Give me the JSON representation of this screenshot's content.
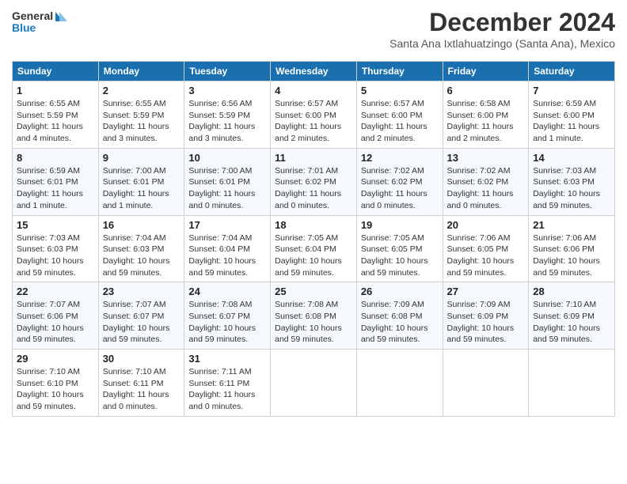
{
  "logo": {
    "line1": "General",
    "line2": "Blue"
  },
  "title": "December 2024",
  "subtitle": "Santa Ana Ixtlahuatzingo (Santa Ana), Mexico",
  "days_of_week": [
    "Sunday",
    "Monday",
    "Tuesday",
    "Wednesday",
    "Thursday",
    "Friday",
    "Saturday"
  ],
  "weeks": [
    [
      {
        "day": "1",
        "info": "Sunrise: 6:55 AM\nSunset: 5:59 PM\nDaylight: 11 hours\nand 4 minutes."
      },
      {
        "day": "2",
        "info": "Sunrise: 6:55 AM\nSunset: 5:59 PM\nDaylight: 11 hours\nand 3 minutes."
      },
      {
        "day": "3",
        "info": "Sunrise: 6:56 AM\nSunset: 5:59 PM\nDaylight: 11 hours\nand 3 minutes."
      },
      {
        "day": "4",
        "info": "Sunrise: 6:57 AM\nSunset: 6:00 PM\nDaylight: 11 hours\nand 2 minutes."
      },
      {
        "day": "5",
        "info": "Sunrise: 6:57 AM\nSunset: 6:00 PM\nDaylight: 11 hours\nand 2 minutes."
      },
      {
        "day": "6",
        "info": "Sunrise: 6:58 AM\nSunset: 6:00 PM\nDaylight: 11 hours\nand 2 minutes."
      },
      {
        "day": "7",
        "info": "Sunrise: 6:59 AM\nSunset: 6:00 PM\nDaylight: 11 hours\nand 1 minute."
      }
    ],
    [
      {
        "day": "8",
        "info": "Sunrise: 6:59 AM\nSunset: 6:01 PM\nDaylight: 11 hours\nand 1 minute."
      },
      {
        "day": "9",
        "info": "Sunrise: 7:00 AM\nSunset: 6:01 PM\nDaylight: 11 hours\nand 1 minute."
      },
      {
        "day": "10",
        "info": "Sunrise: 7:00 AM\nSunset: 6:01 PM\nDaylight: 11 hours\nand 0 minutes."
      },
      {
        "day": "11",
        "info": "Sunrise: 7:01 AM\nSunset: 6:02 PM\nDaylight: 11 hours\nand 0 minutes."
      },
      {
        "day": "12",
        "info": "Sunrise: 7:02 AM\nSunset: 6:02 PM\nDaylight: 11 hours\nand 0 minutes."
      },
      {
        "day": "13",
        "info": "Sunrise: 7:02 AM\nSunset: 6:02 PM\nDaylight: 11 hours\nand 0 minutes."
      },
      {
        "day": "14",
        "info": "Sunrise: 7:03 AM\nSunset: 6:03 PM\nDaylight: 10 hours\nand 59 minutes."
      }
    ],
    [
      {
        "day": "15",
        "info": "Sunrise: 7:03 AM\nSunset: 6:03 PM\nDaylight: 10 hours\nand 59 minutes."
      },
      {
        "day": "16",
        "info": "Sunrise: 7:04 AM\nSunset: 6:03 PM\nDaylight: 10 hours\nand 59 minutes."
      },
      {
        "day": "17",
        "info": "Sunrise: 7:04 AM\nSunset: 6:04 PM\nDaylight: 10 hours\nand 59 minutes."
      },
      {
        "day": "18",
        "info": "Sunrise: 7:05 AM\nSunset: 6:04 PM\nDaylight: 10 hours\nand 59 minutes."
      },
      {
        "day": "19",
        "info": "Sunrise: 7:05 AM\nSunset: 6:05 PM\nDaylight: 10 hours\nand 59 minutes."
      },
      {
        "day": "20",
        "info": "Sunrise: 7:06 AM\nSunset: 6:05 PM\nDaylight: 10 hours\nand 59 minutes."
      },
      {
        "day": "21",
        "info": "Sunrise: 7:06 AM\nSunset: 6:06 PM\nDaylight: 10 hours\nand 59 minutes."
      }
    ],
    [
      {
        "day": "22",
        "info": "Sunrise: 7:07 AM\nSunset: 6:06 PM\nDaylight: 10 hours\nand 59 minutes."
      },
      {
        "day": "23",
        "info": "Sunrise: 7:07 AM\nSunset: 6:07 PM\nDaylight: 10 hours\nand 59 minutes."
      },
      {
        "day": "24",
        "info": "Sunrise: 7:08 AM\nSunset: 6:07 PM\nDaylight: 10 hours\nand 59 minutes."
      },
      {
        "day": "25",
        "info": "Sunrise: 7:08 AM\nSunset: 6:08 PM\nDaylight: 10 hours\nand 59 minutes."
      },
      {
        "day": "26",
        "info": "Sunrise: 7:09 AM\nSunset: 6:08 PM\nDaylight: 10 hours\nand 59 minutes."
      },
      {
        "day": "27",
        "info": "Sunrise: 7:09 AM\nSunset: 6:09 PM\nDaylight: 10 hours\nand 59 minutes."
      },
      {
        "day": "28",
        "info": "Sunrise: 7:10 AM\nSunset: 6:09 PM\nDaylight: 10 hours\nand 59 minutes."
      }
    ],
    [
      {
        "day": "29",
        "info": "Sunrise: 7:10 AM\nSunset: 6:10 PM\nDaylight: 10 hours\nand 59 minutes."
      },
      {
        "day": "30",
        "info": "Sunrise: 7:10 AM\nSunset: 6:11 PM\nDaylight: 11 hours\nand 0 minutes."
      },
      {
        "day": "31",
        "info": "Sunrise: 7:11 AM\nSunset: 6:11 PM\nDaylight: 11 hours\nand 0 minutes."
      },
      {
        "day": "",
        "info": ""
      },
      {
        "day": "",
        "info": ""
      },
      {
        "day": "",
        "info": ""
      },
      {
        "day": "",
        "info": ""
      }
    ]
  ]
}
